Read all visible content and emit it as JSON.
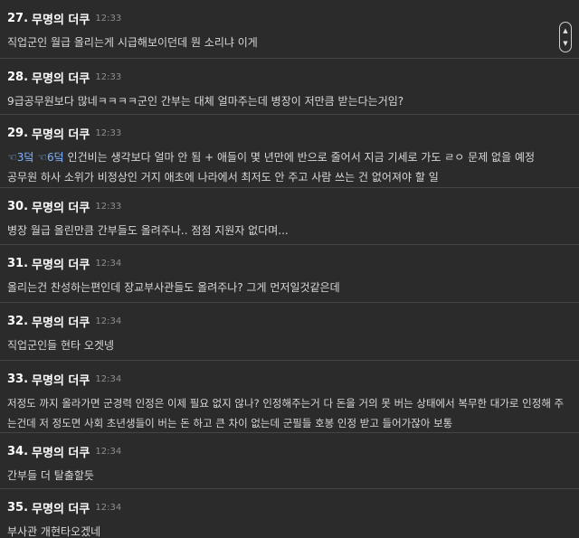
{
  "comments": [
    {
      "number": "27.",
      "author": "무명의 더쿠",
      "time": "12:33",
      "lines": [
        "직업군인 월급 올리는게 시급해보이던데 뭔 소리냐 이게"
      ]
    },
    {
      "number": "28.",
      "author": "무명의 더쿠",
      "time": "12:33",
      "lines": [
        "9급공무원보다 많네ㅋㅋㅋㅋ군인 간부는 대체 얼마주는데 병장이 저만큼 받는다는거임?"
      ]
    },
    {
      "number": "29.",
      "author": "무명의 더쿠",
      "time": "12:33",
      "anchors": [
        "☜3덬",
        "☜6덬"
      ],
      "lines": [
        "인건비는 생각보다 얼마 안 됨 + 애들이 몇 년만에 반으로 줄어서 지금 기세로 가도 ㄹㅇ 문제 없을 예정",
        "공무원 하사 소위가 비정상인 거지 애초에 나라에서 최저도 안 주고 사람 쓰는 건 없어져야 할 일"
      ]
    },
    {
      "number": "30.",
      "author": "무명의 더쿠",
      "time": "12:33",
      "lines": [
        "병장 월급 올린만큼 간부들도 올려주나.. 점점 지원자 없다며..."
      ]
    },
    {
      "number": "31.",
      "author": "무명의 더쿠",
      "time": "12:34",
      "lines": [
        "올리는건 찬성하는편인데 장교부사관들도 올려주나? 그게 먼저일것같은데"
      ]
    },
    {
      "number": "32.",
      "author": "무명의 더쿠",
      "time": "12:34",
      "lines": [
        "직업군인들 현타 오겟넹"
      ]
    },
    {
      "number": "33.",
      "author": "무명의 더쿠",
      "time": "12:34",
      "lines": [
        "저정도 까지 올라가면 군경력 인정은 이제 필요 없지 않나? 인정해주는거 다 돈을 거의 못 버는 상태에서 복무한 대가로 인정해 주",
        "는건데 저 정도면 사회 초년생들이 버는 돈 하고 큰 차이 없는데 군필들 호봉 인정 받고 들어가잖아 보통"
      ]
    },
    {
      "number": "34.",
      "author": "무명의 더쿠",
      "time": "12:34",
      "lines": [
        "간부들 더 탈출할듯"
      ]
    },
    {
      "number": "35.",
      "author": "무명의 더쿠",
      "time": "12:34",
      "lines": [
        "부사관 개현타오겠네"
      ]
    }
  ],
  "scrollbar": {
    "up_icon": "chevron-up-icon",
    "down_icon": "chevron-down-icon"
  }
}
